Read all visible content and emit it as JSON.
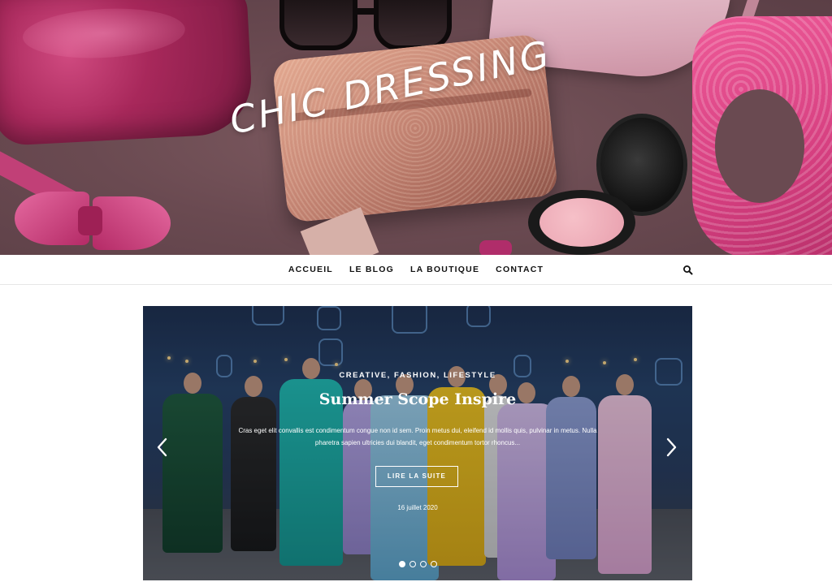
{
  "site": {
    "title": "CHIC DRESSING"
  },
  "nav": {
    "items": [
      {
        "label": "ACCUEIL"
      },
      {
        "label": "LE BLOG"
      },
      {
        "label": "LA BOUTIQUE"
      },
      {
        "label": "CONTACT"
      }
    ],
    "search_icon": "search-icon"
  },
  "slider": {
    "categories": "CREATIVE, FASHION, LIFESTYLE",
    "title": "Summer Scope Inspire",
    "excerpt": "Cras eget elit convallis est condimentum congue non id sem. Proin metus dui, eleifend id mollis quis, pulvinar in metus. Nulla pharetra sapien ultricies dui blandit, eget condimentum tortor rhoncus...",
    "read_more_label": "LIRE LA SUITE",
    "date": "16 juillet 2020",
    "prev_icon": "chevron-left-icon",
    "next_icon": "chevron-right-icon",
    "slide_count": 4,
    "active_slide": 1
  },
  "colors": {
    "text_dark": "#111111",
    "white": "#ffffff"
  }
}
